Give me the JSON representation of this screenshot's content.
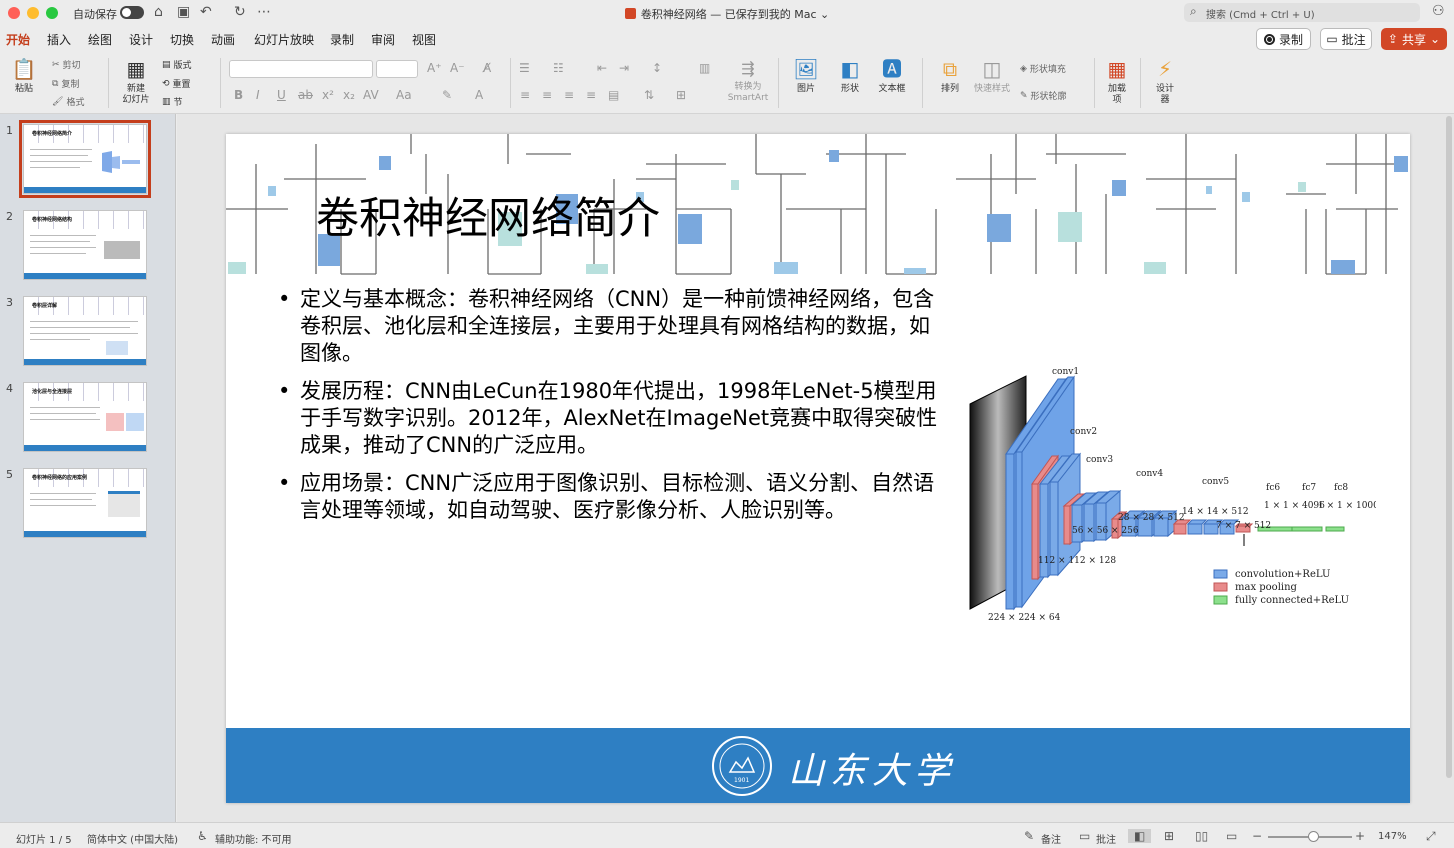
{
  "titlebar": {
    "autosave": "自动保存",
    "doc_title": "卷积神经网络 — 已保存到我的 Mac",
    "search_placeholder": "搜索 (Cmd + Ctrl + U)"
  },
  "tabs": [
    "开始",
    "插入",
    "绘图",
    "设计",
    "切换",
    "动画",
    "幻灯片放映",
    "录制",
    "审阅",
    "视图"
  ],
  "actions": {
    "record": "录制",
    "comment": "批注",
    "share": "共享"
  },
  "ribbon": {
    "paste": "粘贴",
    "cut": "剪切",
    "copy": "复制",
    "format": "格式",
    "new_slide": "新建\n幻灯片",
    "layout": "版式",
    "reset": "重置",
    "section": "节",
    "smartart": "转换为\nSmartArt",
    "picture": "图片",
    "shape": "形状",
    "textbox": "文本框",
    "arrange": "排列",
    "quick_styles": "快速样式",
    "shape_fill": "形状填充",
    "shape_outline": "形状轮廓",
    "addins": "加载\n项",
    "designer": "设计\n器"
  },
  "thumbnails": [
    {
      "num": "1",
      "title": "卷积神经网络简介"
    },
    {
      "num": "2",
      "title": "卷积神经网络结构"
    },
    {
      "num": "3",
      "title": "卷积层详解"
    },
    {
      "num": "4",
      "title": "池化层与全连接层"
    },
    {
      "num": "5",
      "title": "卷积神经网络的应用案例"
    }
  ],
  "slide": {
    "title": "卷积神经网络简介",
    "bullets": [
      "定义与基本概念：卷积神经网络（CNN）是一种前馈神经网络，包含卷积层、池化层和全连接层，主要用于处理具有网格结构的数据，如图像。",
      "发展历程：CNN由LeCun在1980年代提出，1998年LeNet-5模型用于手写数字识别。2012年，AlexNet在ImageNet竞赛中取得突破性成果，推动了CNN的广泛应用。",
      "应用场景：CNN广泛应用于图像识别、目标检测、语义分割、自然语言处理等领域，如自动驾驶、医疗影像分析、人脸识别等。"
    ],
    "figure": {
      "labels": [
        "conv1",
        "conv2",
        "conv3",
        "conv4",
        "conv5",
        "fc6",
        "fc7",
        "fc8"
      ],
      "dims": [
        "224 × 224 × 64",
        "112 × 112 × 128",
        "56 × 56 × 256",
        "28 × 28 × 512",
        "14 × 14 × 512",
        "7 × 7 × 512",
        "1 × 1 × 4096",
        "1 × 1 × 1000"
      ],
      "legend": [
        "convolution+ReLU",
        "max pooling",
        "fully connected+ReLU"
      ]
    },
    "logo_text": "山东大学",
    "seal_year": "1901"
  },
  "status": {
    "slide_count": "幻灯片 1 / 5",
    "language": "简体中文 (中国大陆)",
    "accessibility": "辅助功能: 不可用",
    "notes": "备注",
    "comments": "批注",
    "zoom": "147%"
  },
  "colors": {
    "accent": "#c43e1c",
    "share": "#d24726",
    "band": "#2e7fc3"
  }
}
